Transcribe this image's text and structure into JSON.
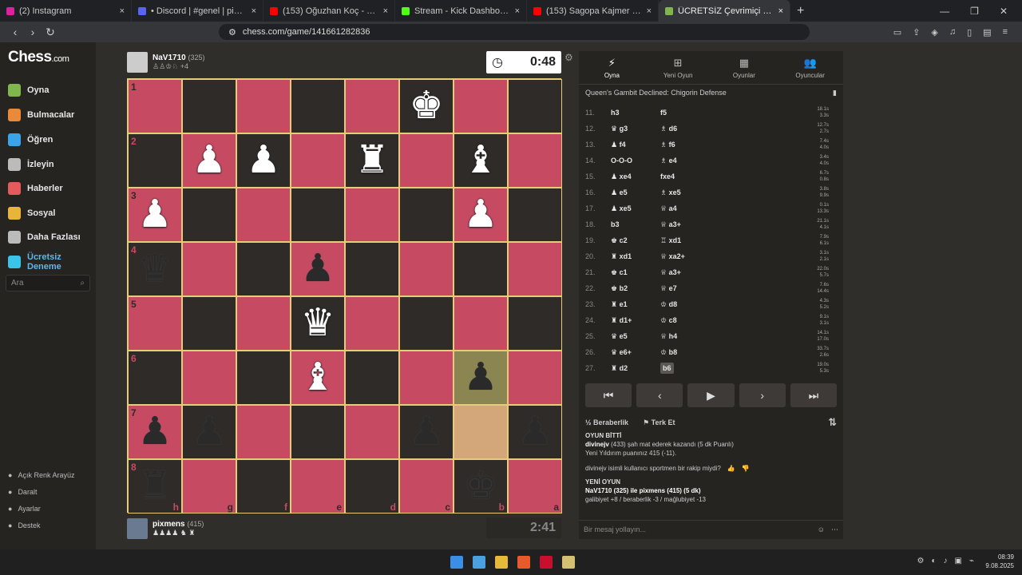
{
  "browser": {
    "tabs": [
      {
        "title": "(2) Instagram",
        "color": "#d6249f",
        "active": false
      },
      {
        "title": "• Discord | #genel | pixmens",
        "color": "#5865f2",
        "active": false
      },
      {
        "title": "(153) Oğuzhan Koç - Bulutlara Esir O",
        "color": "#ff0000",
        "active": false
      },
      {
        "title": "Stream - Kick Dashboard",
        "color": "#53fc18",
        "active": false
      },
      {
        "title": "(153) Sagopa Kajmer & Dr. Fuchs",
        "color": "#ff0000",
        "active": false
      },
      {
        "title": "ÜCRETSİZ Çevrimiçi Satranç (",
        "color": "#81b64c",
        "active": true
      }
    ],
    "new_tab": "+",
    "url": "chess.com/game/141661282836"
  },
  "sidebar": {
    "logo": "Chess",
    "logo_suffix": ".com",
    "items": [
      {
        "label": "Oyna",
        "icon": "pawn-icon",
        "color": "#81b64c"
      },
      {
        "label": "Bulmacalar",
        "icon": "puzzle-icon",
        "color": "#e88a3a"
      },
      {
        "label": "Öğren",
        "icon": "learn-icon",
        "color": "#3aa4e8"
      },
      {
        "label": "İzleyin",
        "icon": "binoculars-icon",
        "color": "#bbbbbb"
      },
      {
        "label": "Haberler",
        "icon": "news-icon",
        "color": "#e35b5b"
      },
      {
        "label": "Sosyal",
        "icon": "social-icon",
        "color": "#e8b43a"
      },
      {
        "label": "Daha Fazlası",
        "icon": "more-icon",
        "color": "#bbbbbb"
      },
      {
        "label": "Ücretsiz Deneme",
        "icon": "diamond-icon",
        "color": "#3ac4e8"
      }
    ],
    "search_placeholder": "Ara",
    "bottom": [
      {
        "label": "Açık Renk Arayüz",
        "icon": "theme-icon"
      },
      {
        "label": "Daralt",
        "icon": "collapse-icon"
      },
      {
        "label": "Ayarlar",
        "icon": "gear-icon"
      },
      {
        "label": "Destek",
        "icon": "help-icon"
      }
    ]
  },
  "game": {
    "top_player": {
      "name": "NaV1710",
      "rating": "(325)",
      "captured": "♙♙♔♘ +4"
    },
    "bottom_player": {
      "name": "pixmens",
      "rating": "(415)",
      "captured": "♟♟♟♟ ♞ ♜"
    },
    "top_clock": "0:48",
    "bottom_clock": "2:41",
    "ranks": [
      "1",
      "2",
      "3",
      "4",
      "5",
      "6",
      "7",
      "8"
    ],
    "files": [
      "h",
      "g",
      "f",
      "e",
      "d",
      "c",
      "b",
      "a"
    ],
    "pieces": {
      "0-5": {
        "g": "♚",
        "c": "w"
      },
      "1-1": {
        "g": "♟",
        "c": "w"
      },
      "1-2": {
        "g": "♟",
        "c": "w"
      },
      "1-4": {
        "g": "♜",
        "c": "w"
      },
      "1-6": {
        "g": "♝",
        "c": "w"
      },
      "2-0": {
        "g": "♟",
        "c": "w"
      },
      "2-6": {
        "g": "♟",
        "c": "w"
      },
      "3-0": {
        "g": "♛",
        "c": "b"
      },
      "3-3": {
        "g": "♟",
        "c": "b"
      },
      "4-3": {
        "g": "♛",
        "c": "w"
      },
      "5-3": {
        "g": "♝",
        "c": "w"
      },
      "5-6": {
        "g": "♟",
        "c": "b"
      },
      "6-0": {
        "g": "♟",
        "c": "b"
      },
      "6-1": {
        "g": "♟",
        "c": "b"
      },
      "6-5": {
        "g": "♟",
        "c": "b"
      },
      "6-7": {
        "g": "♟",
        "c": "b"
      },
      "7-0": {
        "g": "♜",
        "c": "b"
      },
      "7-6": {
        "g": "♚",
        "c": "b"
      }
    },
    "highlights": {
      "5-6": "hl1",
      "6-6": "hl2"
    }
  },
  "panel": {
    "tabs": [
      {
        "label": "Oyna",
        "icon": "⚡"
      },
      {
        "label": "Yeni Oyun",
        "icon": "⊞"
      },
      {
        "label": "Oyunlar",
        "icon": "▦"
      },
      {
        "label": "Oyuncular",
        "icon": "👥"
      }
    ],
    "opening": "Queen's Gambit Declined: Chigorin Defense",
    "moves": [
      {
        "n": "11.",
        "w": "h3",
        "b": "f5",
        "tw": "18.1s",
        "tb": "3.3s"
      },
      {
        "n": "12.",
        "w": "♛ g3",
        "b": "♗ d6",
        "tw": "12.7s",
        "tb": "2.7s"
      },
      {
        "n": "13.",
        "w": "♟ f4",
        "b": "♗ f6",
        "tw": "7.4s",
        "tb": "4.0s"
      },
      {
        "n": "14.",
        "w": "O-O-O",
        "b": "♗ e4",
        "tw": "3.4s",
        "tb": "4.0s"
      },
      {
        "n": "15.",
        "w": "♟ xe4",
        "b": "fxe4",
        "tw": "6.7s",
        "tb": "0.8s"
      },
      {
        "n": "16.",
        "w": "♟ e5",
        "b": "♗ xe5",
        "tw": "3.8s",
        "tb": "9.9s"
      },
      {
        "n": "17.",
        "w": "♟ xe5",
        "b": "♕ a4",
        "tw": "0.1s",
        "tb": "13.3s"
      },
      {
        "n": "18.",
        "w": "b3",
        "b": "♕ a3+",
        "tw": "21.1s",
        "tb": "4.1s"
      },
      {
        "n": "19.",
        "w": "♚ c2",
        "b": "♖ xd1",
        "tw": "7.9s",
        "tb": "6.1s"
      },
      {
        "n": "20.",
        "w": "♜ xd1",
        "b": "♕ xa2+",
        "tw": "3.1s",
        "tb": "2.1s"
      },
      {
        "n": "21.",
        "w": "♚ c1",
        "b": "♕ a3+",
        "tw": "22.0s",
        "tb": "5.7s"
      },
      {
        "n": "22.",
        "w": "♚ b2",
        "b": "♕ e7",
        "tw": "7.6s",
        "tb": "14.4s"
      },
      {
        "n": "23.",
        "w": "♜ e1",
        "b": "♔ d8",
        "tw": "4.3s",
        "tb": "5.2s"
      },
      {
        "n": "24.",
        "w": "♜ d1+",
        "b": "♔ c8",
        "tw": "9.1s",
        "tb": "3.1s"
      },
      {
        "n": "25.",
        "w": "♛ e5",
        "b": "♕ h4",
        "tw": "14.1s",
        "tb": "17.0s"
      },
      {
        "n": "26.",
        "w": "♛ e6+",
        "b": "♔ b8",
        "tw": "33.7s",
        "tb": "2.6s"
      },
      {
        "n": "27.",
        "w": "♜ d2",
        "b": "b6",
        "tw": "19.0s",
        "tb": "5.3s"
      }
    ],
    "controls": [
      "⏮",
      "‹",
      "▶",
      "›",
      "⏭"
    ],
    "draw": "Beraberlik",
    "resign": "Terk Et",
    "chat": {
      "header": "OYUN BİTTİ",
      "line1a": "divinejv",
      "line1b": " (433) şah mat ederek kazandı (5 dk Puanlı)",
      "line2": "Yeni Yıldırım puanınız 415 (-11).",
      "question": "divinejv isimli kullanıcı sportmen bir rakip miydi?",
      "newgame_hd": "YENİ OYUN",
      "newgame": "NaV1710 (325) ile pixmens (415) (5 dk)",
      "stats": "galibiyet +8 / beraberlik -3 / mağlubiyet -13"
    },
    "message_placeholder": "Bir mesaj yollayın..."
  },
  "taskbar": {
    "time": "08:39",
    "date": "9.08.2025"
  }
}
